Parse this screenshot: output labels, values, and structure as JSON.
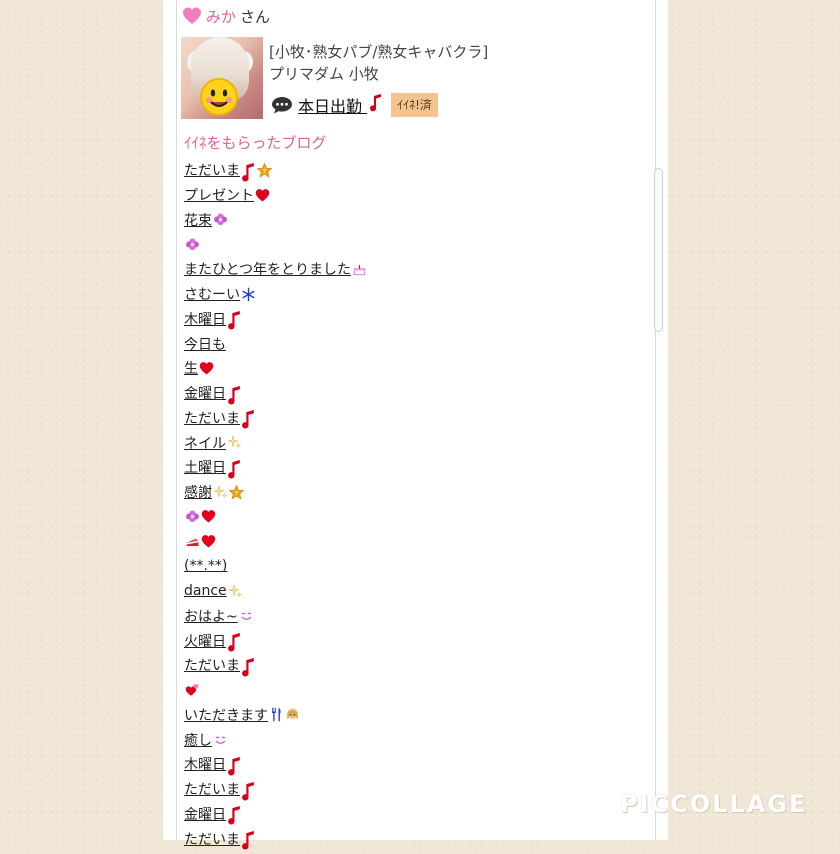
{
  "header": {
    "name": "みか",
    "suffix": "さん"
  },
  "profile": {
    "category": "[小牧･熟女パブ/熟女キャバクラ]",
    "shop": "プリマダム 小牧",
    "work_link": "本日出勤",
    "like_badge": "ｲｲﾈ!済"
  },
  "section_title": "ｲｲﾈをもらったブログ",
  "blogs": [
    {
      "text": "ただいま",
      "icons": [
        "note-icon",
        "star-badge-icon"
      ]
    },
    {
      "text": "プレゼント",
      "icons": [
        "heart-icon"
      ]
    },
    {
      "text": "花束",
      "icons": [
        "flower-icon"
      ]
    },
    {
      "text": "",
      "icons": [
        "flower-icon"
      ]
    },
    {
      "text": "またひとつ年をとりました",
      "icons": [
        "cake-icon"
      ]
    },
    {
      "text": "さむーい",
      "icons": [
        "snowflake-icon"
      ]
    },
    {
      "text": "木曜日",
      "icons": [
        "note-icon"
      ]
    },
    {
      "text": "今日も",
      "icons": []
    },
    {
      "text": "生",
      "icons": [
        "heart-icon"
      ]
    },
    {
      "text": "金曜日",
      "icons": [
        "note-icon"
      ]
    },
    {
      "text": "ただいま",
      "icons": [
        "note-icon"
      ]
    },
    {
      "text": "ネイル",
      "icons": [
        "sparkle-icon"
      ]
    },
    {
      "text": "土曜日",
      "icons": [
        "note-icon"
      ]
    },
    {
      "text": "感謝",
      "icons": [
        "sparkle-icon",
        "star-badge-icon"
      ]
    },
    {
      "text": "",
      "icons": [
        "flower-icon",
        "heart-icon"
      ]
    },
    {
      "text": "",
      "icons": [
        "cake-slice-icon",
        "heart-icon"
      ]
    },
    {
      "text": "(**.**)",
      "icons": []
    },
    {
      "text": "dance",
      "icons": [
        "sparkle-icon"
      ]
    },
    {
      "text": "おはよ~",
      "icons": [
        "smile-icon"
      ]
    },
    {
      "text": "火曜日",
      "icons": [
        "note-icon"
      ]
    },
    {
      "text": "ただいま",
      "icons": [
        "note-icon"
      ]
    },
    {
      "text": "",
      "icons": [
        "hearts-icon"
      ]
    },
    {
      "text": "いただきます",
      "icons": [
        "cutlery-icon",
        "girl-icon"
      ]
    },
    {
      "text": "癒し",
      "icons": [
        "smile-icon"
      ]
    },
    {
      "text": "木曜日",
      "icons": [
        "note-icon"
      ]
    },
    {
      "text": "ただいま",
      "icons": [
        "note-icon"
      ]
    },
    {
      "text": "金曜日",
      "icons": [
        "note-icon"
      ]
    },
    {
      "text": "ただいま",
      "icons": [
        "note-icon"
      ]
    }
  ],
  "watermark": "PICCOLLAGE",
  "colors": {
    "accent": "#e0609a",
    "badge": "#f3c48f",
    "background": "#efe6d6"
  }
}
